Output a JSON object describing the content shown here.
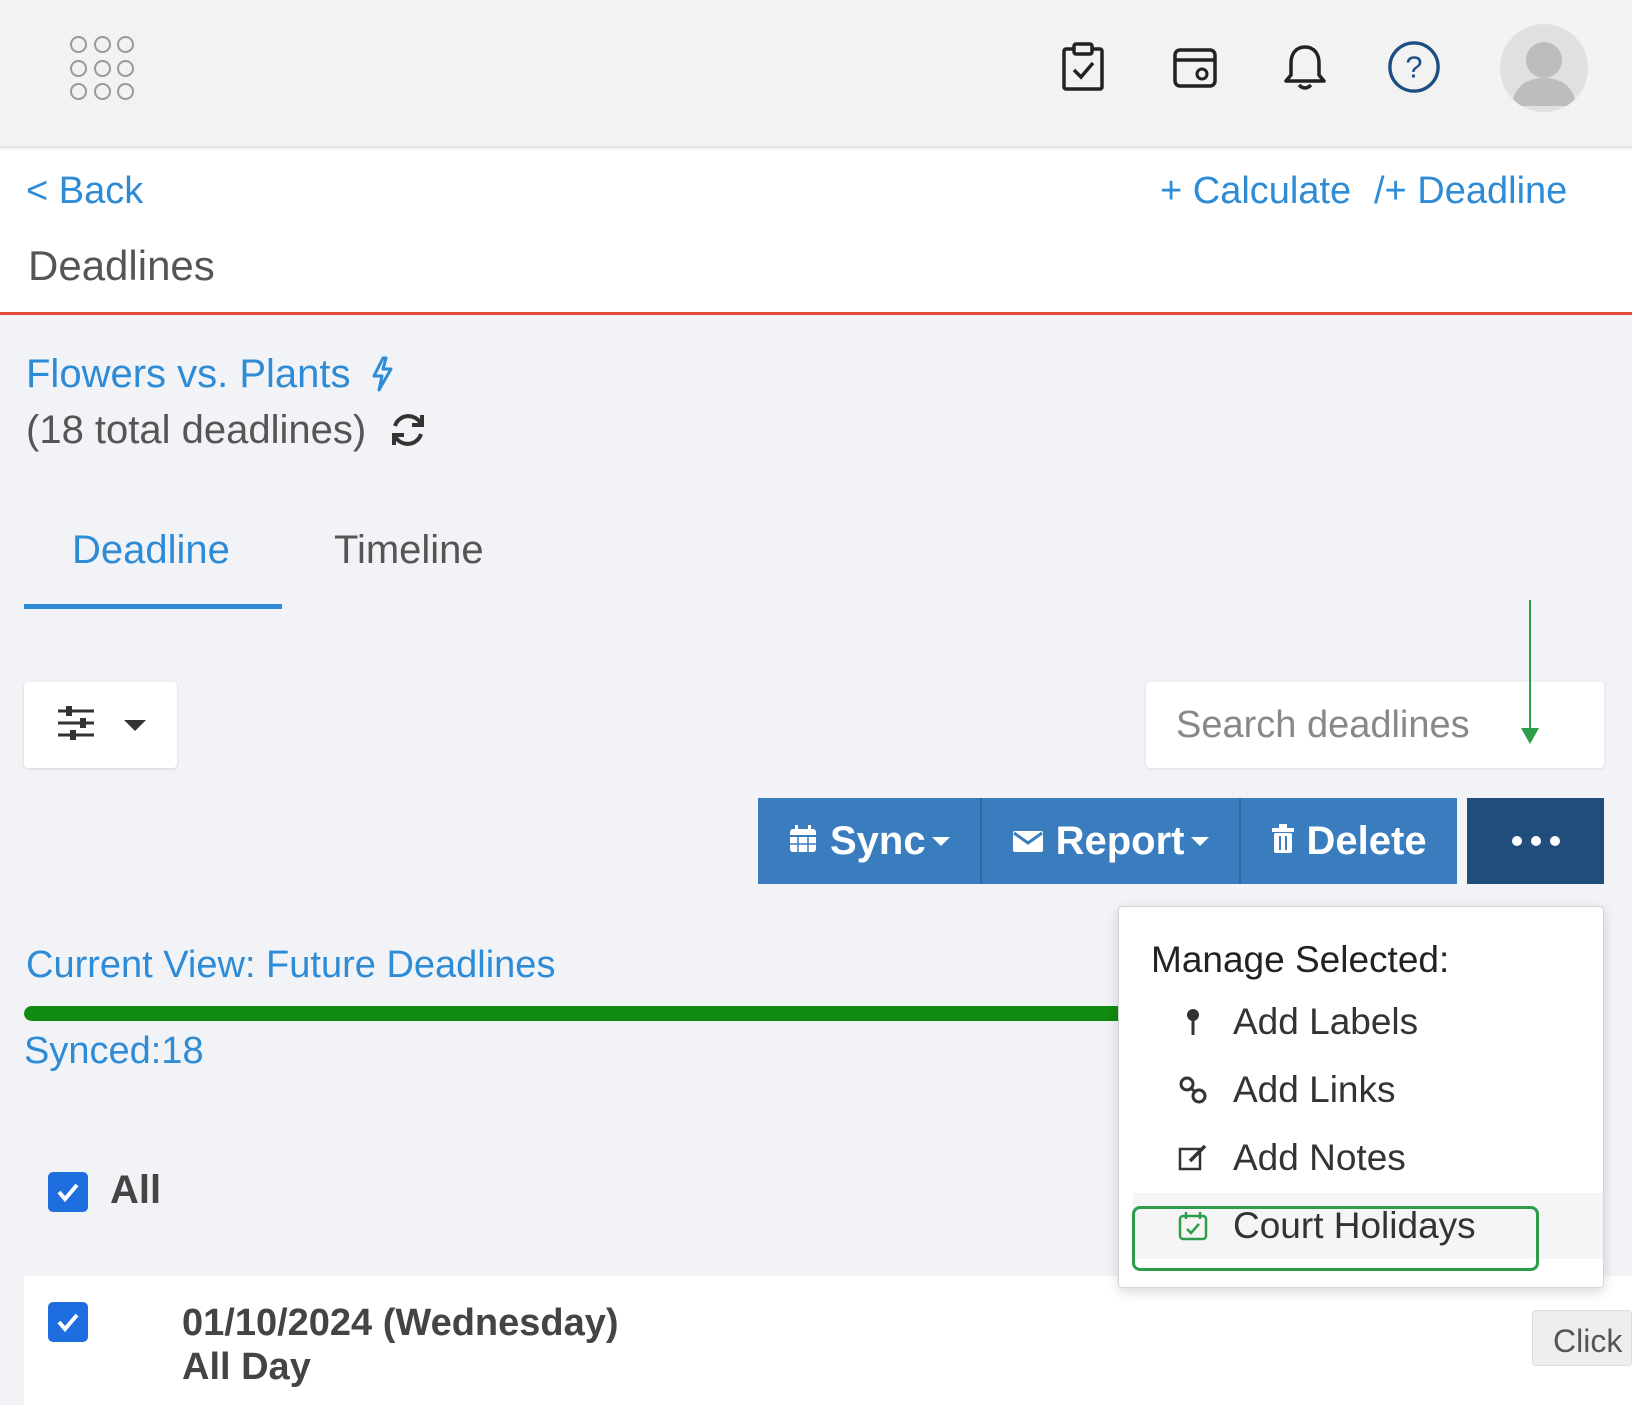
{
  "topbar": {
    "icons": [
      "apps-grid-icon",
      "clipboard-check-icon",
      "calendar-icon",
      "bell-icon",
      "help-icon",
      "avatar"
    ]
  },
  "header": {
    "back_label": "< Back",
    "calculate_label": "+ Calculate",
    "add_deadline_label": "/+ Deadline",
    "page_title": "Deadlines"
  },
  "case": {
    "name": "Flowers vs. Plants",
    "total": "(18 total deadlines)"
  },
  "tabs": [
    {
      "label": "Deadline",
      "active": true
    },
    {
      "label": "Timeline",
      "active": false
    }
  ],
  "search": {
    "placeholder": "Search deadlines"
  },
  "actions": {
    "sync_label": "Sync",
    "report_label": "Report",
    "delete_label": "Delete",
    "more_label": "..."
  },
  "status": {
    "current_view": "Current View: Future Deadlines",
    "synced": "Synced:18",
    "progress_fraction": 1.0
  },
  "list": {
    "all_label": "All",
    "all_checked": true,
    "rows": [
      {
        "date": "01/10/2024 (Wednesday)",
        "time": "All Day",
        "checked": true
      }
    ]
  },
  "dropdown": {
    "header": "Manage Selected:",
    "items": [
      {
        "label": "Add Labels",
        "icon": "pin-icon"
      },
      {
        "label": "Add Links",
        "icon": "link-icon"
      },
      {
        "label": "Add Notes",
        "icon": "edit-icon"
      },
      {
        "label": "Court Holidays",
        "icon": "calendar-check-icon"
      }
    ]
  },
  "tooltip": {
    "text": "Click"
  },
  "colors": {
    "link_blue": "#2e8bd6",
    "button_blue": "#3a7dbf",
    "button_dark": "#214d7c",
    "header_border_red": "#e54a3c",
    "progress_green": "#118a11",
    "highlight_green": "#2e9d4a"
  }
}
